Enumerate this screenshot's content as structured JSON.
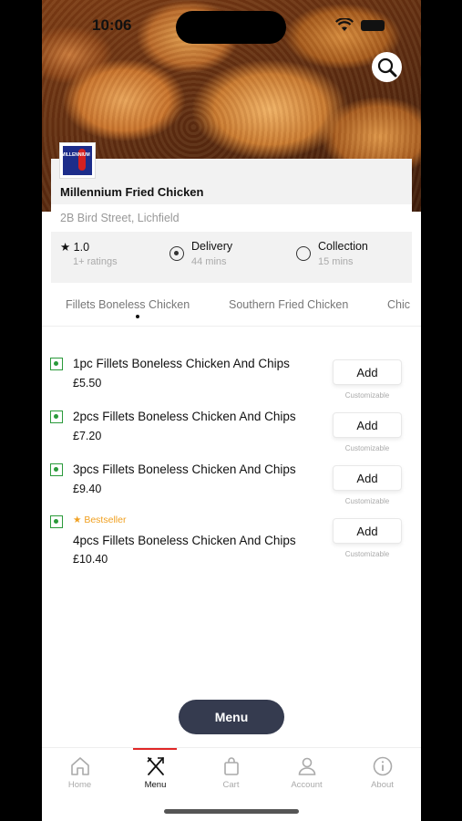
{
  "status": {
    "time": "10:06"
  },
  "restaurant": {
    "name": "Millennium Fried Chicken",
    "address": "2B Bird Street, Lichfield",
    "logo_text": "MILLENNIUM",
    "rating": "★ 1.0",
    "ratings_count": "1+ ratings"
  },
  "order_modes": [
    {
      "label": "Delivery",
      "sub": "44 mins",
      "selected": true
    },
    {
      "label": "Collection",
      "sub": "15 mins",
      "selected": false
    }
  ],
  "tabs": [
    "Fillets Boneless Chicken",
    "Southern Fried Chicken",
    "Chic"
  ],
  "items": [
    {
      "name": "1pc Fillets Boneless Chicken And Chips",
      "price": "£5.50",
      "add": "Add",
      "note": "Customizable"
    },
    {
      "name": "2pcs Fillets Boneless Chicken And Chips",
      "price": "£7.20",
      "add": "Add",
      "note": "Customizable"
    },
    {
      "name": "3pcs Fillets Boneless Chicken And Chips",
      "price": "£9.40",
      "add": "Add",
      "note": "Customizable"
    },
    {
      "name": "4pcs Fillets Boneless Chicken And Chips",
      "price": "£10.40",
      "add": "Add",
      "note": "Customizable",
      "badge": "Bestseller"
    }
  ],
  "menu_button": "Menu",
  "nav": [
    {
      "label": "Home",
      "icon": "home-icon"
    },
    {
      "label": "Menu",
      "icon": "fork-knife-icon",
      "active": true
    },
    {
      "label": "Cart",
      "icon": "bag-icon"
    },
    {
      "label": "Account",
      "icon": "user-icon"
    },
    {
      "label": "About",
      "icon": "info-icon"
    }
  ],
  "colors": {
    "accent": "#e02828",
    "veg": "#2a9a3a",
    "bestseller": "#f0a020",
    "menu_pill": "#353b4f"
  }
}
